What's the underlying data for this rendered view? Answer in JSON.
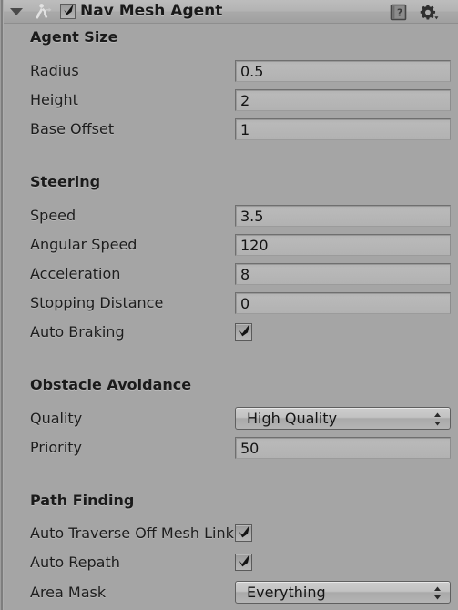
{
  "header": {
    "title": "Nav Mesh Agent",
    "foldout_icon": "triangle-down-icon",
    "component_icon": "navmesh-agent-icon",
    "enabled_checkbox": true,
    "help_icon": "help-book-icon",
    "settings_icon": "gear-dropdown-icon"
  },
  "sections": [
    {
      "title": "Agent Size",
      "rows": [
        {
          "label": "Radius",
          "type": "number",
          "value": "0.5"
        },
        {
          "label": "Height",
          "type": "number",
          "value": "2"
        },
        {
          "label": "Base Offset",
          "type": "number",
          "value": "1"
        }
      ]
    },
    {
      "title": "Steering",
      "rows": [
        {
          "label": "Speed",
          "type": "number",
          "value": "3.5"
        },
        {
          "label": "Angular Speed",
          "type": "number",
          "value": "120"
        },
        {
          "label": "Acceleration",
          "type": "number",
          "value": "8"
        },
        {
          "label": "Stopping Distance",
          "type": "number",
          "value": "0"
        },
        {
          "label": "Auto Braking",
          "type": "checkbox",
          "value": true
        }
      ]
    },
    {
      "title": "Obstacle Avoidance",
      "rows": [
        {
          "label": "Quality",
          "type": "dropdown",
          "value": "High Quality"
        },
        {
          "label": "Priority",
          "type": "number",
          "value": "50"
        }
      ]
    },
    {
      "title": "Path Finding",
      "rows": [
        {
          "label": "Auto Traverse Off Mesh Link",
          "type": "checkbox",
          "value": true
        },
        {
          "label": "Auto Repath",
          "type": "checkbox",
          "value": true
        },
        {
          "label": "Area Mask",
          "type": "dropdown",
          "value": "Everything"
        }
      ]
    }
  ],
  "colors": {
    "panel_bg": "#a5a5a5",
    "header_bg": "#b3b3b3",
    "text": "#1d1d1d",
    "field_bg": "#b5b5b5",
    "field_border": "#6f6f6f"
  }
}
